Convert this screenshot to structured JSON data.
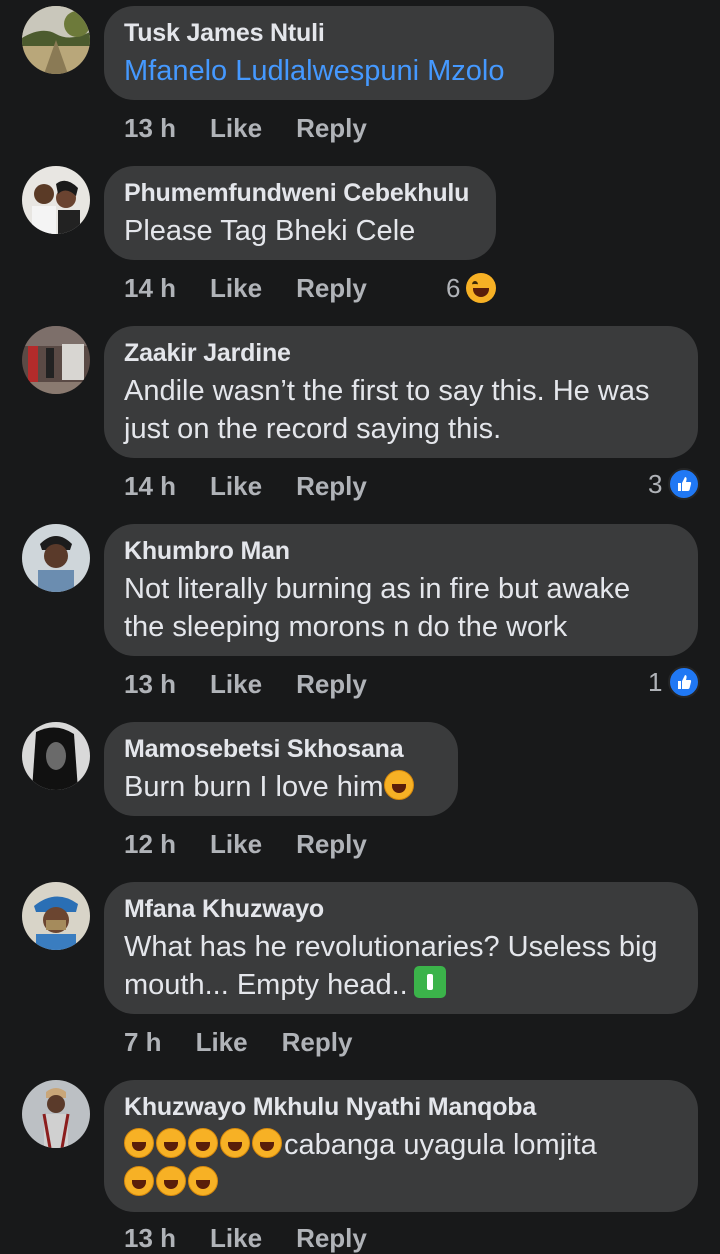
{
  "comments": [
    {
      "name": "Tusk James Ntuli",
      "text": "Mfanelo Ludlalwespuni Mzolo",
      "time": "13 h",
      "like": "Like",
      "reply": "Reply",
      "reactions": ""
    },
    {
      "name": "Phumemfundweni Cebekhulu",
      "text": "Please Tag Bheki Cele",
      "time": "14 h",
      "like": "Like",
      "reply": "Reply",
      "reactions": "6"
    },
    {
      "name": "Zaakir Jardine",
      "text": "Andile wasn’t the first to say this. He was just on the record saying this.",
      "time": "14 h",
      "like": "Like",
      "reply": "Reply",
      "reactions": "3"
    },
    {
      "name": "Khumbro Man",
      "text": "Not literally burning as in fire but awake the sleeping morons n do the work",
      "time": "13 h",
      "like": "Like",
      "reply": "Reply",
      "reactions": "1"
    },
    {
      "name": "Mamosebetsi Skhosana",
      "text": "Burn burn I love him",
      "time": "12 h",
      "like": "Like",
      "reply": "Reply",
      "reactions": ""
    },
    {
      "name": "Mfana Khuzwayo",
      "text": "What has he revolutionaries? Useless big mouth... Empty head..",
      "time": "7 h",
      "like": "Like",
      "reply": "Reply",
      "reactions": ""
    },
    {
      "name": "Khuzwayo Mkhulu Nyathi Manqoba",
      "text": "cabanga uyagula lomjita",
      "time": "13 h",
      "like": "Like",
      "reply": "Reply",
      "reactions": ""
    }
  ],
  "colors": {
    "background": "#18191a",
    "bubble": "#3a3b3c",
    "link": "#4599ff",
    "like_badge": "#2078f4",
    "meta": "#b0b3b8"
  },
  "icons": {
    "laugh": "laugh-emoji-icon",
    "like": "like-thumb-icon",
    "trash": "litter-bin-icon"
  }
}
